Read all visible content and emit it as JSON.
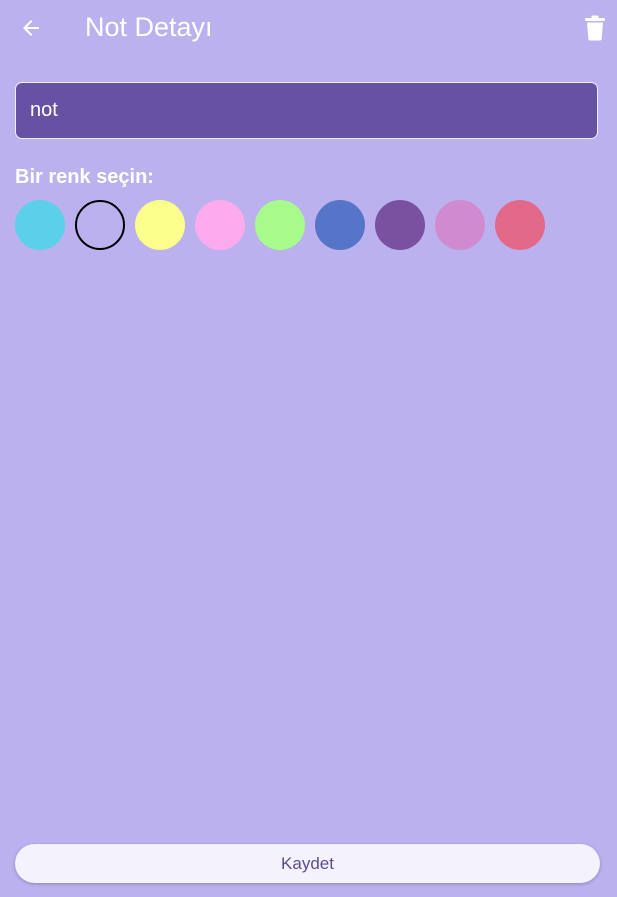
{
  "app_bar": {
    "title": "Not Detayı",
    "back_icon": "arrow-left-icon",
    "delete_icon": "trash-icon"
  },
  "note": {
    "value": "not"
  },
  "color_picker": {
    "label": "Bir renk seçin:",
    "selected_index": 1,
    "colors": [
      {
        "name": "cyan",
        "hex": "#5ccfea"
      },
      {
        "name": "selected-current",
        "hex": "#bbb1ee"
      },
      {
        "name": "yellow",
        "hex": "#fafe8a"
      },
      {
        "name": "pink",
        "hex": "#feaaee"
      },
      {
        "name": "green",
        "hex": "#a6fb8a"
      },
      {
        "name": "blue",
        "hex": "#5674c8"
      },
      {
        "name": "purple",
        "hex": "#7a50a0"
      },
      {
        "name": "orchid",
        "hex": "#d08bd0"
      },
      {
        "name": "rose",
        "hex": "#e2698a"
      }
    ]
  },
  "actions": {
    "save_label": "Kaydet"
  },
  "theme": {
    "background": "#bbb1ee",
    "field_fill": "#6751a2",
    "text_on_dark": "#ffffff",
    "button_fill": "#f4f3fd",
    "button_text": "#5d4b8e"
  }
}
